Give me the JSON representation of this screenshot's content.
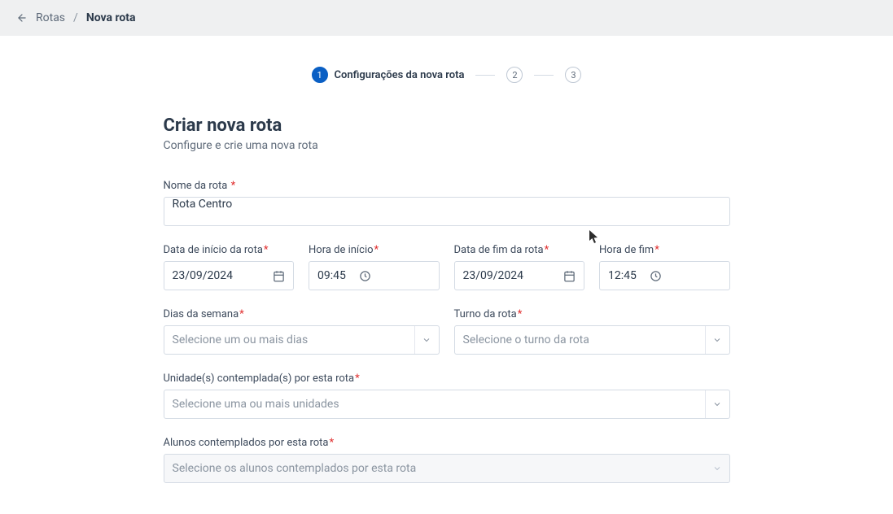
{
  "breadcrumb": {
    "parent": "Rotas",
    "sep": "/",
    "current": "Nova rota"
  },
  "stepper": {
    "step1": {
      "num": "1",
      "label": "Configurações da nova rota"
    },
    "step2": {
      "num": "2"
    },
    "step3": {
      "num": "3"
    }
  },
  "header": {
    "title": "Criar nova rota",
    "subtitle": "Configure e crie uma nova rota"
  },
  "fields": {
    "name": {
      "label": "Nome da rota",
      "value": "Rota Centro"
    },
    "start_date": {
      "label": "Data de início da rota",
      "value": "23/09/2024"
    },
    "start_time": {
      "label": "Hora de início",
      "value": "09:45"
    },
    "end_date": {
      "label": "Data de fim da rota",
      "value": "23/09/2024"
    },
    "end_time": {
      "label": "Hora de fim",
      "value": "12:45"
    },
    "days": {
      "label": "Dias da semana",
      "placeholder": "Selecione um ou mais dias"
    },
    "shift": {
      "label": "Turno da rota",
      "placeholder": "Selecione o turno da rota"
    },
    "units": {
      "label": "Unidade(s) contemplada(s) por esta rota",
      "placeholder": "Selecione uma ou mais unidades"
    },
    "students": {
      "label": "Alunos contemplados por esta rota",
      "placeholder": "Selecione os alunos contemplados por esta rota"
    }
  }
}
